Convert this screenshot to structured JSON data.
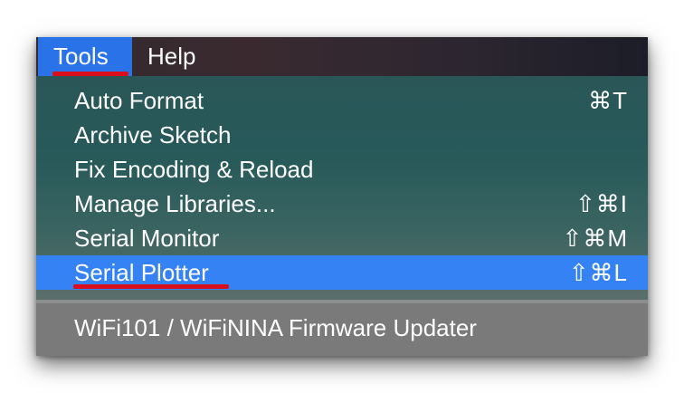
{
  "menubar": {
    "items": [
      {
        "label": "Tools",
        "active": true
      },
      {
        "label": "Help",
        "active": false
      }
    ]
  },
  "menu": {
    "items": [
      {
        "label": "Auto Format",
        "shortcut": "⌘T"
      },
      {
        "label": "Archive Sketch",
        "shortcut": ""
      },
      {
        "label": "Fix Encoding & Reload",
        "shortcut": ""
      },
      {
        "label": "Manage Libraries...",
        "shortcut": "⇧⌘I"
      },
      {
        "label": "Serial Monitor",
        "shortcut": "⇧⌘M"
      },
      {
        "label": "Serial Plotter",
        "shortcut": "⇧⌘L",
        "highlighted": true
      }
    ],
    "lower_items": [
      {
        "label": "WiFi101 / WiFiNINA Firmware Updater",
        "shortcut": ""
      }
    ]
  },
  "colors": {
    "active_blue": "#2a72e8",
    "highlight_blue": "#3482f4",
    "annotation_red": "#d9101c"
  }
}
